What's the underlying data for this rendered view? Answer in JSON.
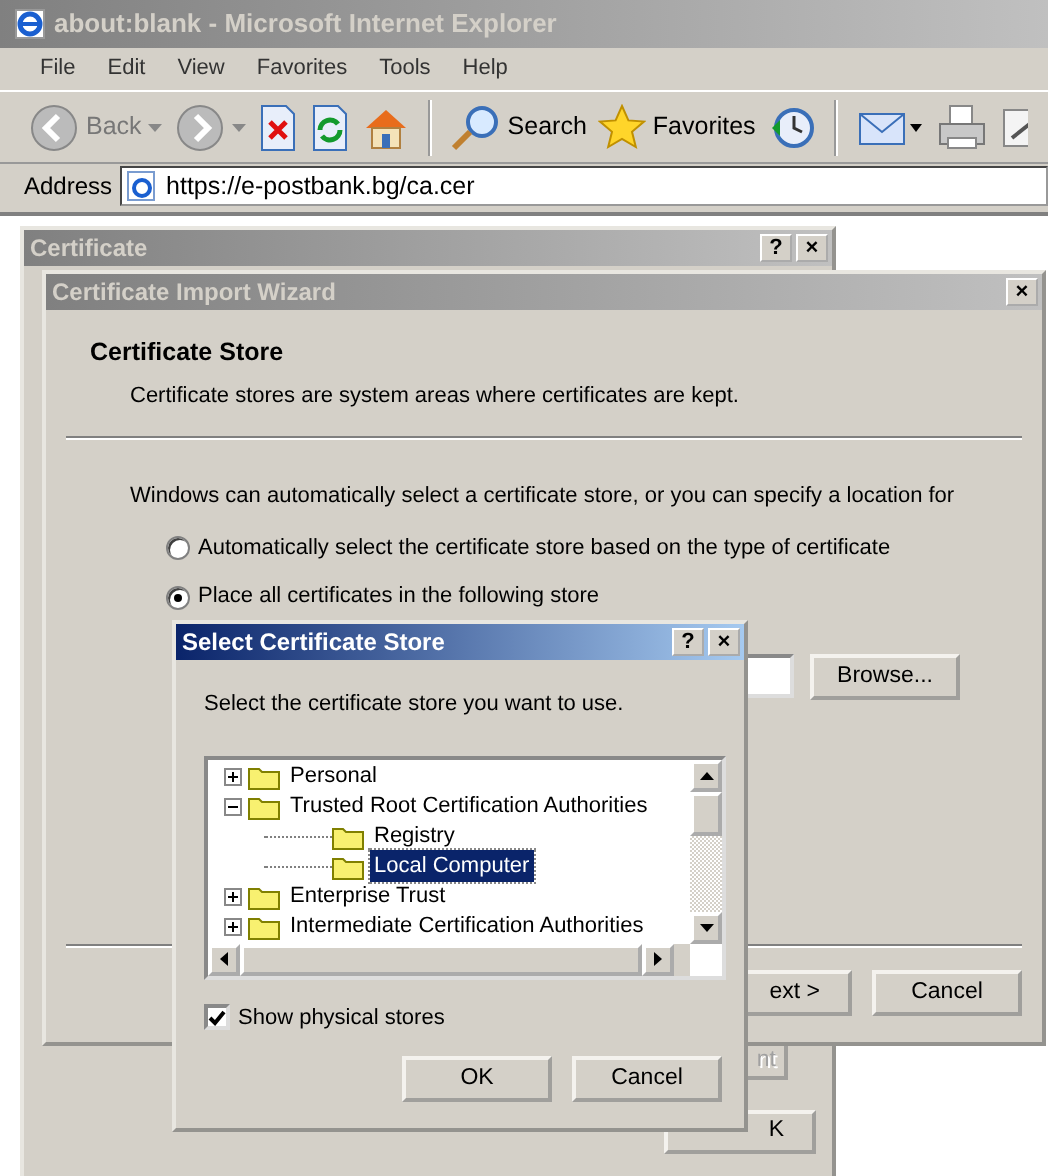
{
  "browser": {
    "title": "about:blank - Microsoft Internet Explorer",
    "menu": [
      "File",
      "Edit",
      "View",
      "Favorites",
      "Tools",
      "Help"
    ],
    "toolbar": [
      {
        "kind": "back",
        "label": "Back"
      },
      {
        "kind": "forward"
      },
      {
        "kind": "stop"
      },
      {
        "kind": "refresh"
      },
      {
        "kind": "home"
      },
      {
        "kind": "search",
        "label": "Search"
      },
      {
        "kind": "favorites",
        "label": "Favorites"
      },
      {
        "kind": "history"
      },
      {
        "kind": "mail"
      },
      {
        "kind": "print"
      },
      {
        "kind": "edit"
      }
    ],
    "address_label": "Address",
    "address": "https://e-postbank.bg/ca.cer"
  },
  "certificate_dialog": {
    "title": "Certificate",
    "title_buttons": [
      "?",
      "×"
    ],
    "buttons": [
      {
        "label": "nt",
        "disabled": true
      },
      {
        "label": "K",
        "disabled": false
      }
    ]
  },
  "wizard": {
    "title": "Certificate Import Wizard",
    "title_buttons": [
      "×"
    ],
    "heading": "Certificate Store",
    "subheading": "Certificate stores are system areas where certificates are kept.",
    "intro": "Windows can automatically select a certificate store, or you can specify a location for",
    "options": [
      {
        "label": "Automatically select the certificate store based on the type of certificate",
        "selected": false
      },
      {
        "label": "Place all certificates in the following store",
        "selected": true
      }
    ],
    "browse": "Browse...",
    "next": "ext >",
    "cancel": "Cancel"
  },
  "select_store": {
    "title": "Select Certificate Store",
    "title_buttons": [
      "?",
      "×"
    ],
    "prompt": "Select the certificate store you want to use.",
    "tree": [
      {
        "label": "Personal",
        "expanded": false,
        "selected": false
      },
      {
        "label": "Trusted Root Certification Authorities",
        "expanded": true,
        "selected": false,
        "children": [
          {
            "label": "Registry",
            "selected": false
          },
          {
            "label": "Local Computer",
            "selected": true
          }
        ]
      },
      {
        "label": "Enterprise Trust",
        "expanded": false,
        "selected": false
      },
      {
        "label": "Intermediate Certification Authorities",
        "expanded": false,
        "selected": false
      }
    ],
    "show_physical": {
      "label": "Show physical stores",
      "checked": true
    },
    "buttons": [
      "OK",
      "Cancel"
    ]
  }
}
